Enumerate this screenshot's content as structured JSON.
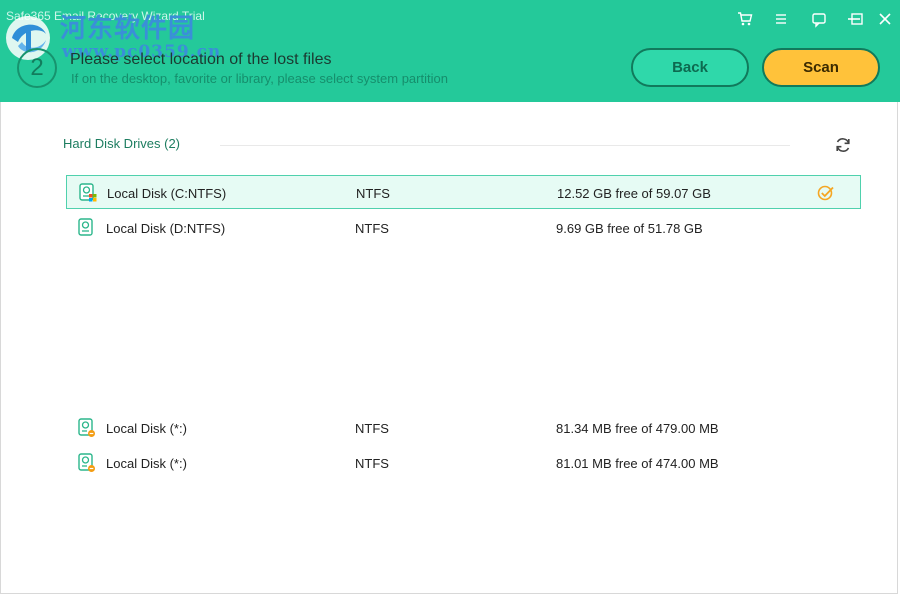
{
  "app": {
    "title": "Safe365 Email Recovery Wizard Trial",
    "watermark_text": "河东软件园",
    "watermark_url": "www.pc0359.cn"
  },
  "window_controls": [
    "cart-icon",
    "menu-icon",
    "feedback-icon",
    "minimize-icon",
    "maximize-icon",
    "close-icon"
  ],
  "step": {
    "number": "2",
    "title": "Please select location of the lost files",
    "subtitle": "If on the desktop, favorite or library, please select system partition"
  },
  "buttons": {
    "back": "Back",
    "scan": "Scan"
  },
  "section": {
    "title": "Hard Disk Drives (2)"
  },
  "drives": [
    {
      "name": "Local Disk (C:NTFS)",
      "fs": "NTFS",
      "space": "12.52 GB free of 59.07 GB",
      "selected": true,
      "icon": "windows-drive-icon"
    },
    {
      "name": "Local Disk (D:NTFS)",
      "fs": "NTFS",
      "space": "9.69 GB free of 51.78 GB",
      "selected": false,
      "icon": "drive-icon"
    },
    {
      "name": "Local Disk (*:)",
      "fs": "NTFS",
      "space": "81.34 MB free of 479.00 MB",
      "selected": false,
      "icon": "hidden-drive-icon"
    },
    {
      "name": "Local Disk (*:)",
      "fs": "NTFS",
      "space": "81.01 MB free of 474.00 MB",
      "selected": false,
      "icon": "hidden-drive-icon"
    }
  ],
  "colors": {
    "header": "#24c99a",
    "back_button": "#2fd8aa",
    "scan_button": "#ffc23a",
    "selected_row": "#e6fbf4",
    "check": "#f5a623"
  }
}
